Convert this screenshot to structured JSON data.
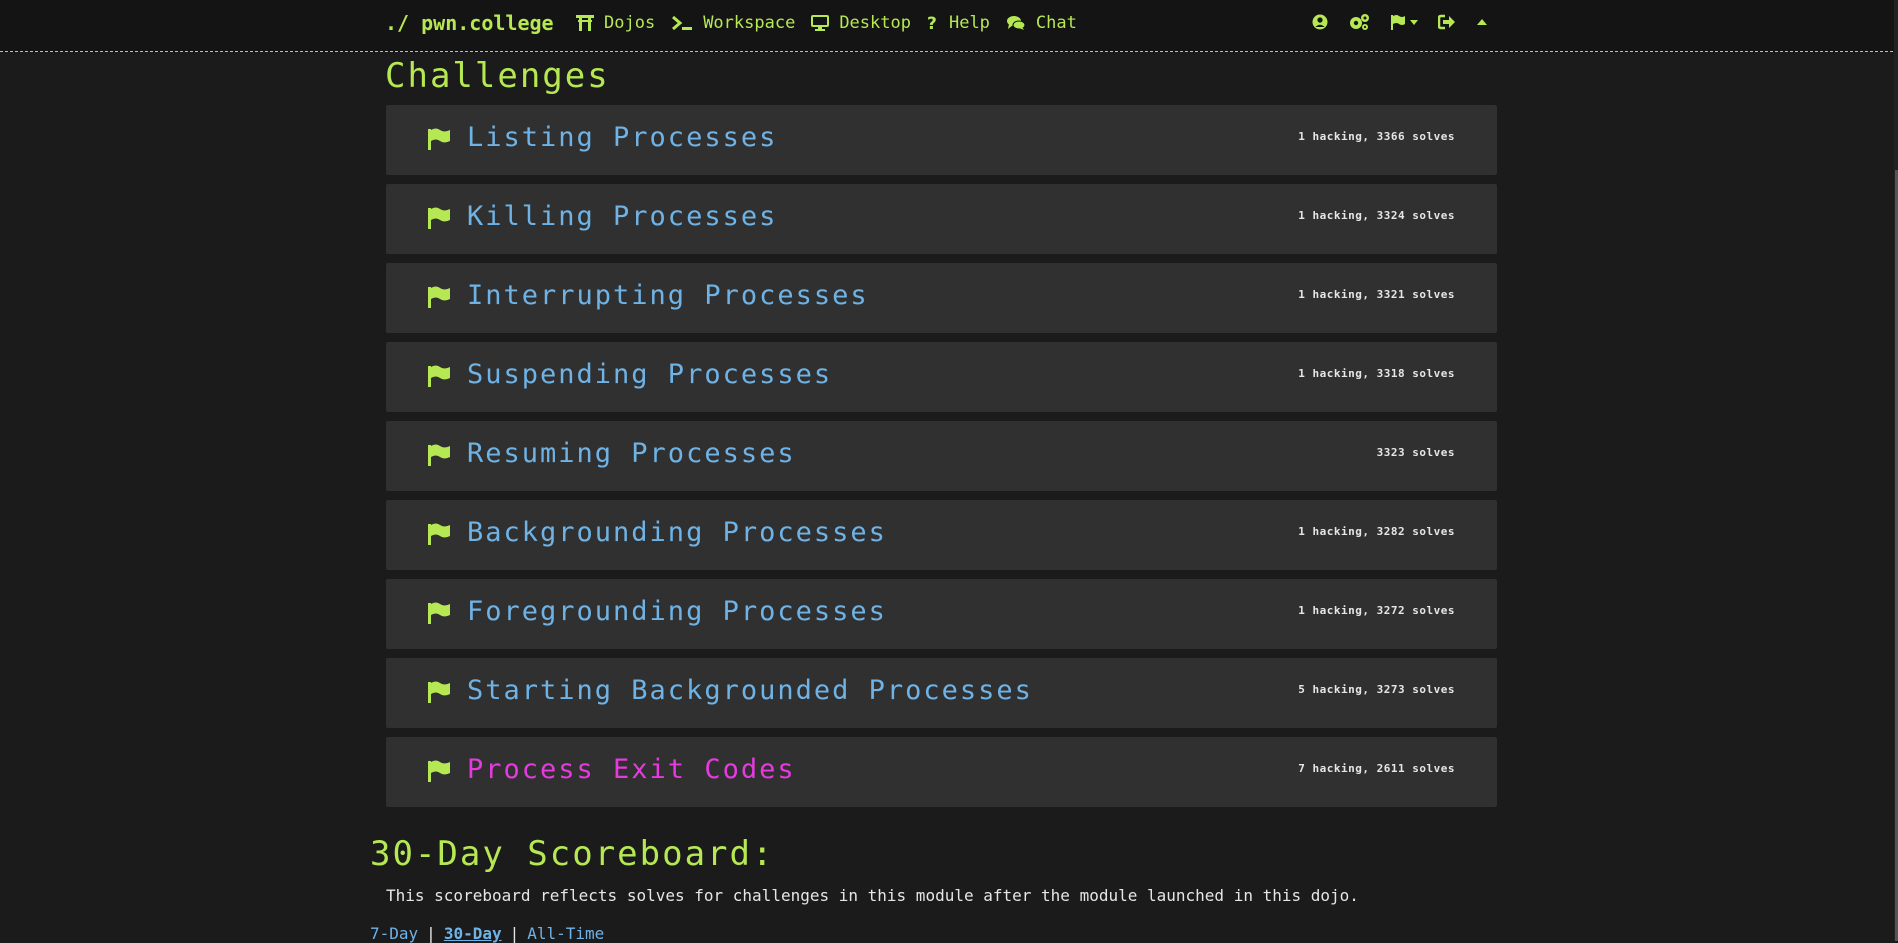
{
  "navbar": {
    "brand": "./ pwn.college",
    "items": [
      {
        "label": "Dojos",
        "icon": "torii-gate-icon"
      },
      {
        "label": "Workspace",
        "icon": "terminal-icon"
      },
      {
        "label": "Desktop",
        "icon": "desktop-icon"
      },
      {
        "label": "Help",
        "icon": "question-icon"
      },
      {
        "label": "Chat",
        "icon": "comments-icon"
      }
    ],
    "right_icons": [
      "user-circle-icon",
      "settings-icon",
      "flag-dropdown-icon",
      "logout-icon",
      "collapse-up-icon"
    ],
    "accent_color": "#b5e853"
  },
  "challenges": {
    "title": "Challenges",
    "items": [
      {
        "name": "Listing Processes",
        "stats": "1 hacking, 3366 solves",
        "solved": true
      },
      {
        "name": "Killing Processes",
        "stats": "1 hacking, 3324 solves",
        "solved": true
      },
      {
        "name": "Interrupting Processes",
        "stats": "1 hacking, 3321 solves",
        "solved": true
      },
      {
        "name": "Suspending Processes",
        "stats": "1 hacking, 3318 solves",
        "solved": true
      },
      {
        "name": "Resuming Processes",
        "stats": "3323 solves",
        "solved": true
      },
      {
        "name": "Backgrounding Processes",
        "stats": "1 hacking, 3282 solves",
        "solved": true
      },
      {
        "name": "Foregrounding Processes",
        "stats": "1 hacking, 3272 solves",
        "solved": true
      },
      {
        "name": "Starting Backgrounded Processes",
        "stats": "5 hacking, 3273 solves",
        "solved": true
      },
      {
        "name": "Process Exit Codes",
        "stats": "7 hacking, 2611 solves",
        "solved": false
      }
    ],
    "solved_color": "#6fb3e6",
    "unsolved_color": "#e63adf"
  },
  "scoreboard": {
    "title": "30-Day Scoreboard:",
    "description": "This scoreboard reflects solves for challenges in this module after the module launched in this dojo.",
    "tabs": [
      {
        "label": "7-Day",
        "active": false
      },
      {
        "label": "30-Day",
        "active": true
      },
      {
        "label": "All-Time",
        "active": false
      }
    ],
    "separator": "|"
  }
}
